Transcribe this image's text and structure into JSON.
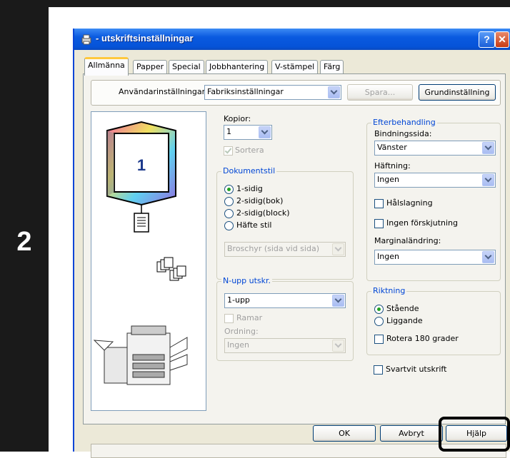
{
  "step": "2",
  "window": {
    "title": "- utskriftsinställningar",
    "help_glyph": "?",
    "close_glyph": "✕"
  },
  "tabs": [
    "Allmänna",
    "Papper",
    "Special",
    "Jobbhantering",
    "V-stämpel",
    "Färg"
  ],
  "user_settings": {
    "label": "Användarinställningar:",
    "value": "Fabriksinställningar",
    "save_label": "Spara...",
    "defaults_label": "Grundinställning"
  },
  "preview": {
    "page_number": "1"
  },
  "copies": {
    "label": "Kopior:",
    "value": "1",
    "collate_label": "Sortera"
  },
  "document_style": {
    "title": "Dokumentstil",
    "options": [
      "1-sidig",
      "2-sidig(bok)",
      "2-sidig(block)",
      "Häfte stil"
    ],
    "selected": "1-sidig",
    "booklet_value": "Broschyr (sida vid sida)"
  },
  "n_up": {
    "title": "N-upp utskr.",
    "value": "1-upp",
    "border_label": "Ramar",
    "order_label": "Ordning:",
    "order_value": "Ingen"
  },
  "finishing": {
    "title": "Efterbehandling",
    "binding_label": "Bindningssida:",
    "binding_value": "Vänster",
    "staple_label": "Häftning:",
    "staple_value": "Ingen",
    "punch_label": "Hålslagning",
    "no_offset_label": "Ingen förskjutning",
    "margin_label": "Marginaländring:",
    "margin_value": "Ingen"
  },
  "orientation": {
    "title": "Riktning",
    "options": [
      "Stående",
      "Liggande"
    ],
    "selected": "Stående",
    "rotate_label": "Rotera 180 grader"
  },
  "bw_print_label": "Svartvit utskrift",
  "footer": {
    "ok": "OK",
    "cancel": "Avbryt",
    "help": "Hjälp"
  }
}
